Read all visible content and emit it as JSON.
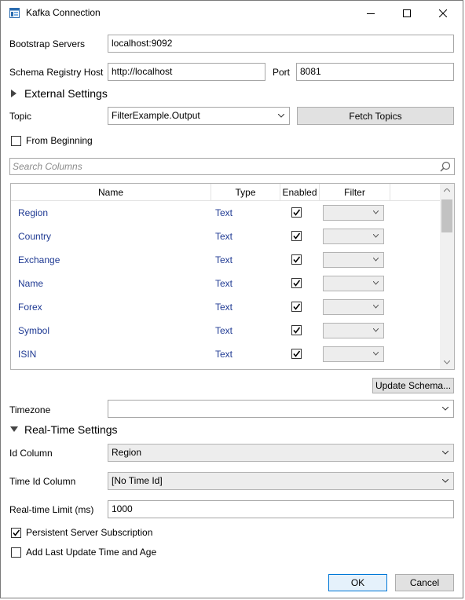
{
  "window": {
    "title": "Kafka Connection",
    "minimize_icon": "minimize-icon",
    "maximize_icon": "maximize-icon",
    "close_icon": "close-icon"
  },
  "bootstrap": {
    "label": "Bootstrap Servers",
    "value": "localhost:9092"
  },
  "schema_registry": {
    "host_label": "Schema Registry Host",
    "host_value": "http://localhost",
    "port_label": "Port",
    "port_value": "8081"
  },
  "external_settings": {
    "label": "External Settings",
    "icon": "expand-triangle-icon"
  },
  "topic": {
    "label": "Topic",
    "value": "FilterExample.Output",
    "fetch_label": "Fetch Topics"
  },
  "from_beginning": {
    "label": "From Beginning",
    "checked": false
  },
  "search": {
    "placeholder": "Search Columns",
    "icon": "search-icon"
  },
  "columns": {
    "headers": [
      "Name",
      "Type",
      "Enabled",
      "Filter"
    ],
    "rows": [
      {
        "name": "Region",
        "type": "Text",
        "enabled": true
      },
      {
        "name": "Country",
        "type": "Text",
        "enabled": true
      },
      {
        "name": "Exchange",
        "type": "Text",
        "enabled": true
      },
      {
        "name": "Name",
        "type": "Text",
        "enabled": true
      },
      {
        "name": "Forex",
        "type": "Text",
        "enabled": true
      },
      {
        "name": "Symbol",
        "type": "Text",
        "enabled": true
      },
      {
        "name": "ISIN",
        "type": "Text",
        "enabled": true
      }
    ]
  },
  "update_schema_label": "Update Schema...",
  "timezone": {
    "label": "Timezone",
    "value": ""
  },
  "realtime": {
    "label": "Real-Time Settings",
    "id_label": "Id Column",
    "id_value": "Region",
    "time_id_label": "Time Id Column",
    "time_id_value": "[No Time Id]",
    "limit_label": "Real-time Limit (ms)",
    "limit_value": "1000"
  },
  "persistent": {
    "label": "Persistent Server Subscription",
    "checked": true
  },
  "add_last_update": {
    "label": "Add Last Update Time and Age",
    "checked": false
  },
  "buttons": {
    "ok": "OK",
    "cancel": "Cancel"
  }
}
